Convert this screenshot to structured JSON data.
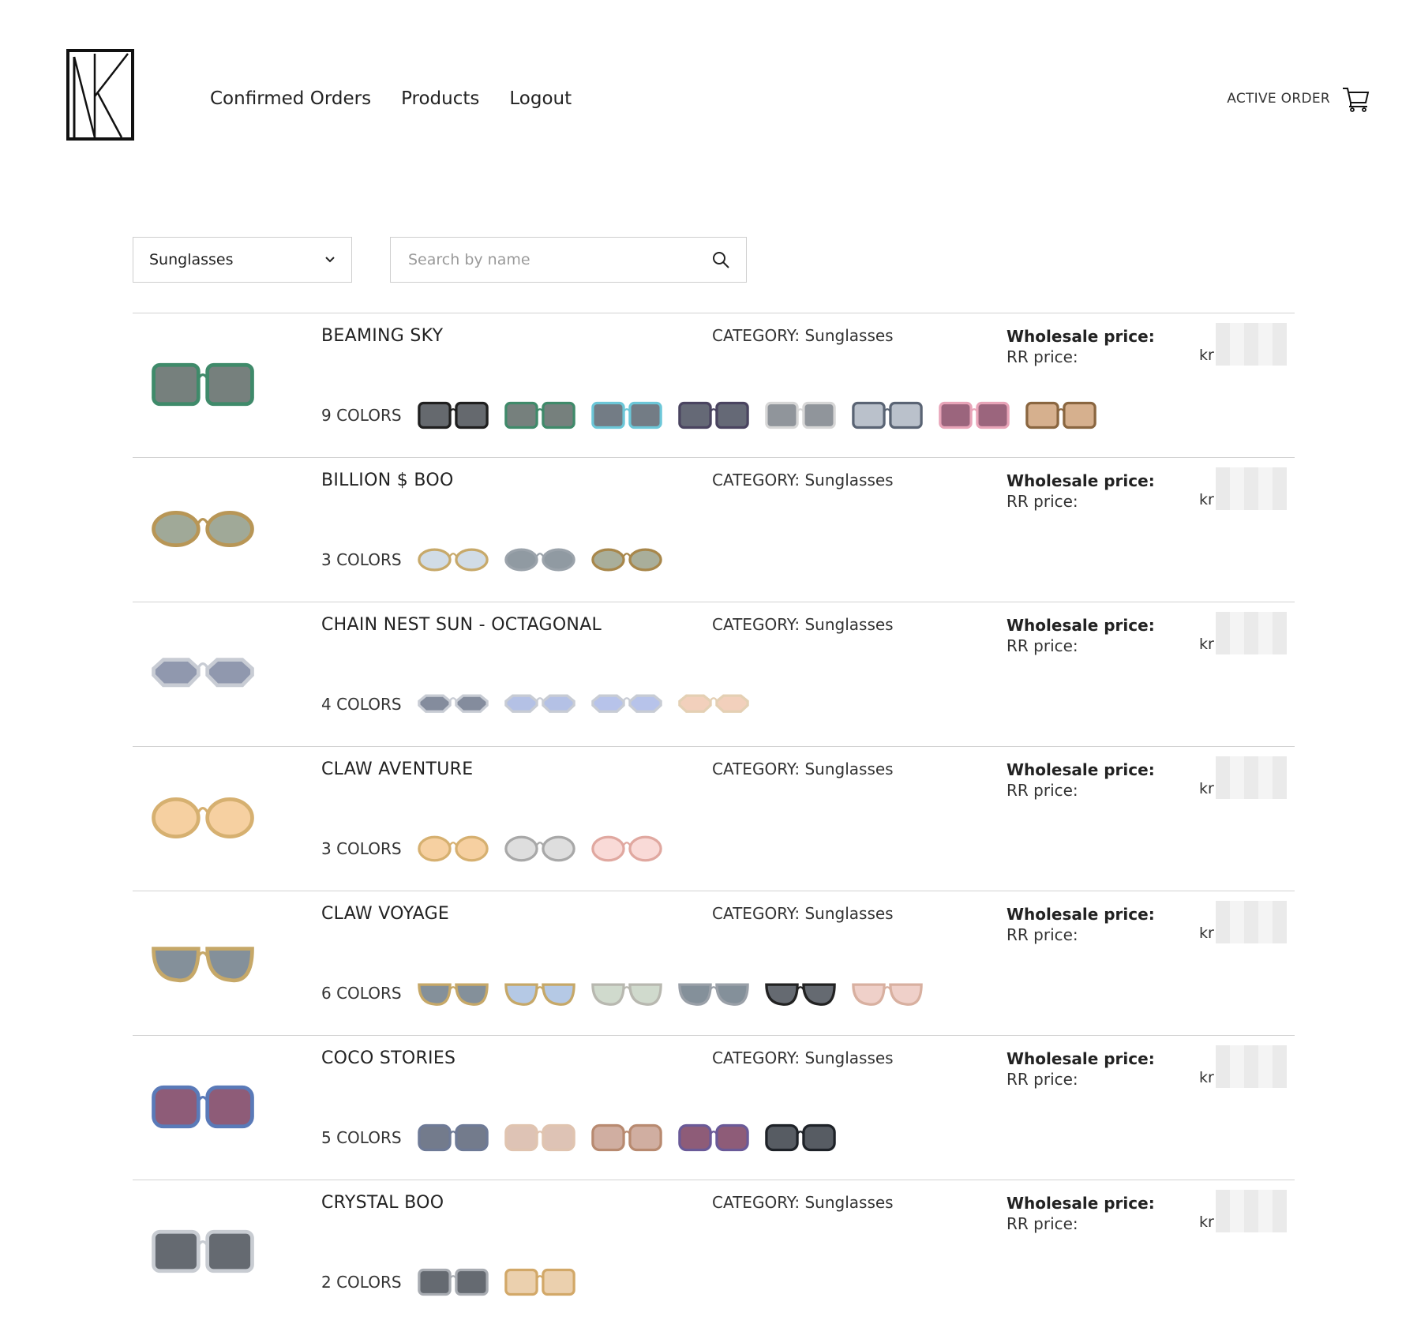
{
  "header": {
    "nav": [
      "Confirmed Orders",
      "Products",
      "Logout"
    ],
    "active_order_label": "ACTIVE ORDER"
  },
  "filters": {
    "category_selected": "Sunglasses",
    "search_placeholder": "Search by name"
  },
  "labels": {
    "category_prefix": "CATEGORY: ",
    "wholesale": "Wholesale price:",
    "rr": "RR price:",
    "currency": "kr"
  },
  "products": [
    {
      "name": "BEAMING SKY",
      "category": "Sunglasses",
      "colors_label": "9 COLORS",
      "shape": "square",
      "frame": "#3f8a6a",
      "lens": "#5e6a66",
      "swatches": [
        [
          "#1f1f1f",
          "#4a4f55"
        ],
        [
          "#3f8a6a",
          "#5e6a66"
        ],
        [
          "#6cc7d8",
          "#5b6570"
        ],
        [
          "#4a4460",
          "#4a4f5e"
        ],
        [
          "#d6d6d6",
          "#7c828a"
        ],
        [
          "#5a6474",
          "#aeb6c2"
        ],
        [
          "#e8a4b8",
          "#8a4a66"
        ],
        [
          "#8a6640",
          "#cfa27a"
        ]
      ]
    },
    {
      "name": "BILLION $  BOO",
      "category": "Sunglasses",
      "colors_label": "3 COLORS",
      "shape": "oval",
      "frame": "#b89656",
      "lens": "#8f9a86",
      "swatches": [
        [
          "#c7a96a",
          "#c9d6e2"
        ],
        [
          "#9ba3ab",
          "#7d8892"
        ],
        [
          "#a8874b",
          "#9aa088"
        ]
      ]
    },
    {
      "name": "CHAIN  NEST SUN - OCTAGONAL",
      "category": "Sunglasses",
      "colors_label": "4 COLORS",
      "shape": "octagon",
      "frame": "#c8ccd4",
      "lens": "#7c86a0",
      "swatches": [
        [
          "#c8ccd4",
          "#6f788c"
        ],
        [
          "#c8ccd4",
          "#a7b6e0"
        ],
        [
          "#c8ccd4",
          "#aab8e6"
        ],
        [
          "#e4d0b4",
          "#f0c8b0"
        ]
      ]
    },
    {
      "name": "CLAW AVENTURE",
      "category": "Sunglasses",
      "colors_label": "3 COLORS",
      "shape": "round",
      "frame": "#d6b070",
      "lens": "#f4c890",
      "swatches": [
        [
          "#d6b070",
          "#f4c890"
        ],
        [
          "#a8a8a8",
          "#d8d8d8"
        ],
        [
          "#e0a8a0",
          "#f8d4d0"
        ]
      ]
    },
    {
      "name": "CLAW VOYAGE",
      "category": "Sunglasses",
      "colors_label": "6 COLORS",
      "shape": "aviator",
      "frame": "#c6a868",
      "lens": "#6f7c88",
      "swatches": [
        [
          "#c6a868",
          "#6f7c88"
        ],
        [
          "#c6a868",
          "#a8c0e0"
        ],
        [
          "#b8b8b0",
          "#c8d4c4"
        ],
        [
          "#9aa0a8",
          "#6f7c88"
        ],
        [
          "#222222",
          "#4a5058"
        ],
        [
          "#d8b0a0",
          "#ecc8c0"
        ]
      ]
    },
    {
      "name": "COCO STORIES",
      "category": "Sunglasses",
      "colors_label": "5 COLORS",
      "shape": "cat",
      "frame": "#5a7ab8",
      "lens": "#7a4060",
      "swatches": [
        [
          "#6e7a96",
          "#5a6478"
        ],
        [
          "#e0c4b0",
          "#d8b8a8"
        ],
        [
          "#b88a70",
          "#c8a090"
        ],
        [
          "#6a5a98",
          "#7a4060"
        ],
        [
          "#1e2228",
          "#3a4048"
        ]
      ]
    },
    {
      "name": "CRYSTAL  BOO",
      "category": "Sunglasses",
      "colors_label": "2 COLORS",
      "shape": "square",
      "frame": "#c8ccd2",
      "lens": "#4a5058",
      "swatches": [
        [
          "#a8acb2",
          "#4a5058"
        ],
        [
          "#d2a868",
          "#e8c8a0"
        ]
      ]
    }
  ]
}
